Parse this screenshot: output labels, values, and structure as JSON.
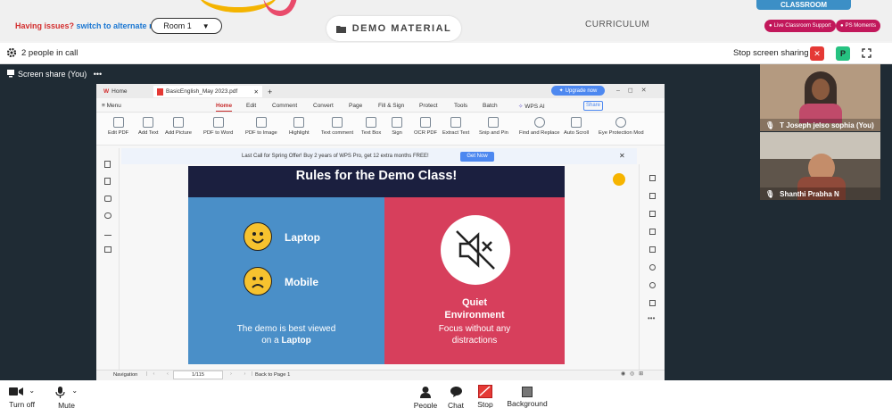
{
  "colors": {
    "accent_red": "#d32f2f",
    "link_blue": "#1976d2",
    "brand_blue": "#3c8fc6",
    "pill_red": "#c2185b",
    "stage": "#1f2b34",
    "slide_navy": "#1b1f3f",
    "slide_blue": "#4a8fc8",
    "slide_red": "#d73f5c"
  },
  "header": {
    "issues_text": "Having issues?",
    "switch_link": "switch to alternate room",
    "room_label": "Room 1",
    "demo_material_label": "DEMO MATERIAL",
    "curriculum_label": "CURRICULUM",
    "classroom_tab": "CLASSROOM",
    "live_support_label": "Live Classroom Support",
    "ps_moments_label": "PS Moments"
  },
  "callbar": {
    "people_in_call": "2 people in call",
    "stop_share_label": "Stop screen sharing",
    "participant_initial": "P"
  },
  "screenshare": {
    "label": "Screen share (You)",
    "more": "•••"
  },
  "app": {
    "tabs": [
      {
        "label": "Home"
      },
      {
        "label": "BasicEnglish_May 2023.pdf"
      }
    ],
    "upgrade_label": "Upgrade now",
    "menu_label": "Menu",
    "menu_items": [
      "Home",
      "Edit",
      "Comment",
      "Convert",
      "Page",
      "Fill & Sign",
      "Protect",
      "Tools",
      "Batch"
    ],
    "wps_ai_label": "WPS AI",
    "share_label": "Share",
    "ribbon": [
      "Edit PDF",
      "Add Text",
      "Add Picture",
      "PDF to Word",
      "PDF to Image",
      "Highlight",
      "Text comment",
      "Text Box",
      "Sign",
      "OCR PDF",
      "Extract Text",
      "Snip and Pin",
      "Find and Replace",
      "Auto Scroll",
      "Eye Protection Mod"
    ],
    "promo_text": "Last Call for Spring Offer! Buy 2 years of WPS Pro, get 12 extra months FREE!",
    "promo_button": "Get Now",
    "status": {
      "navigation": "Navigation",
      "page": "1/115",
      "back_to_page": "Back to Page 1"
    }
  },
  "slide": {
    "title": "Rules for the Demo Class!",
    "laptop": "Laptop",
    "mobile": "Mobile",
    "view_line1": "The demo is best viewed",
    "view_line2_prefix": "on a",
    "view_line2_bold": "Laptop",
    "quiet_line1": "Quiet",
    "quiet_line2": "Environment",
    "focus_line1": "Focus without any",
    "focus_line2": "distractions"
  },
  "participants": [
    {
      "name": "T Joseph jelso sophia (You)"
    },
    {
      "name": "Shanthi Prabha N"
    }
  ],
  "toolbar": {
    "camera_label": "Turn off",
    "mic_label": "Mute",
    "people_label": "People",
    "chat_label": "Chat",
    "stop_label": "Stop",
    "background_label": "Background"
  }
}
